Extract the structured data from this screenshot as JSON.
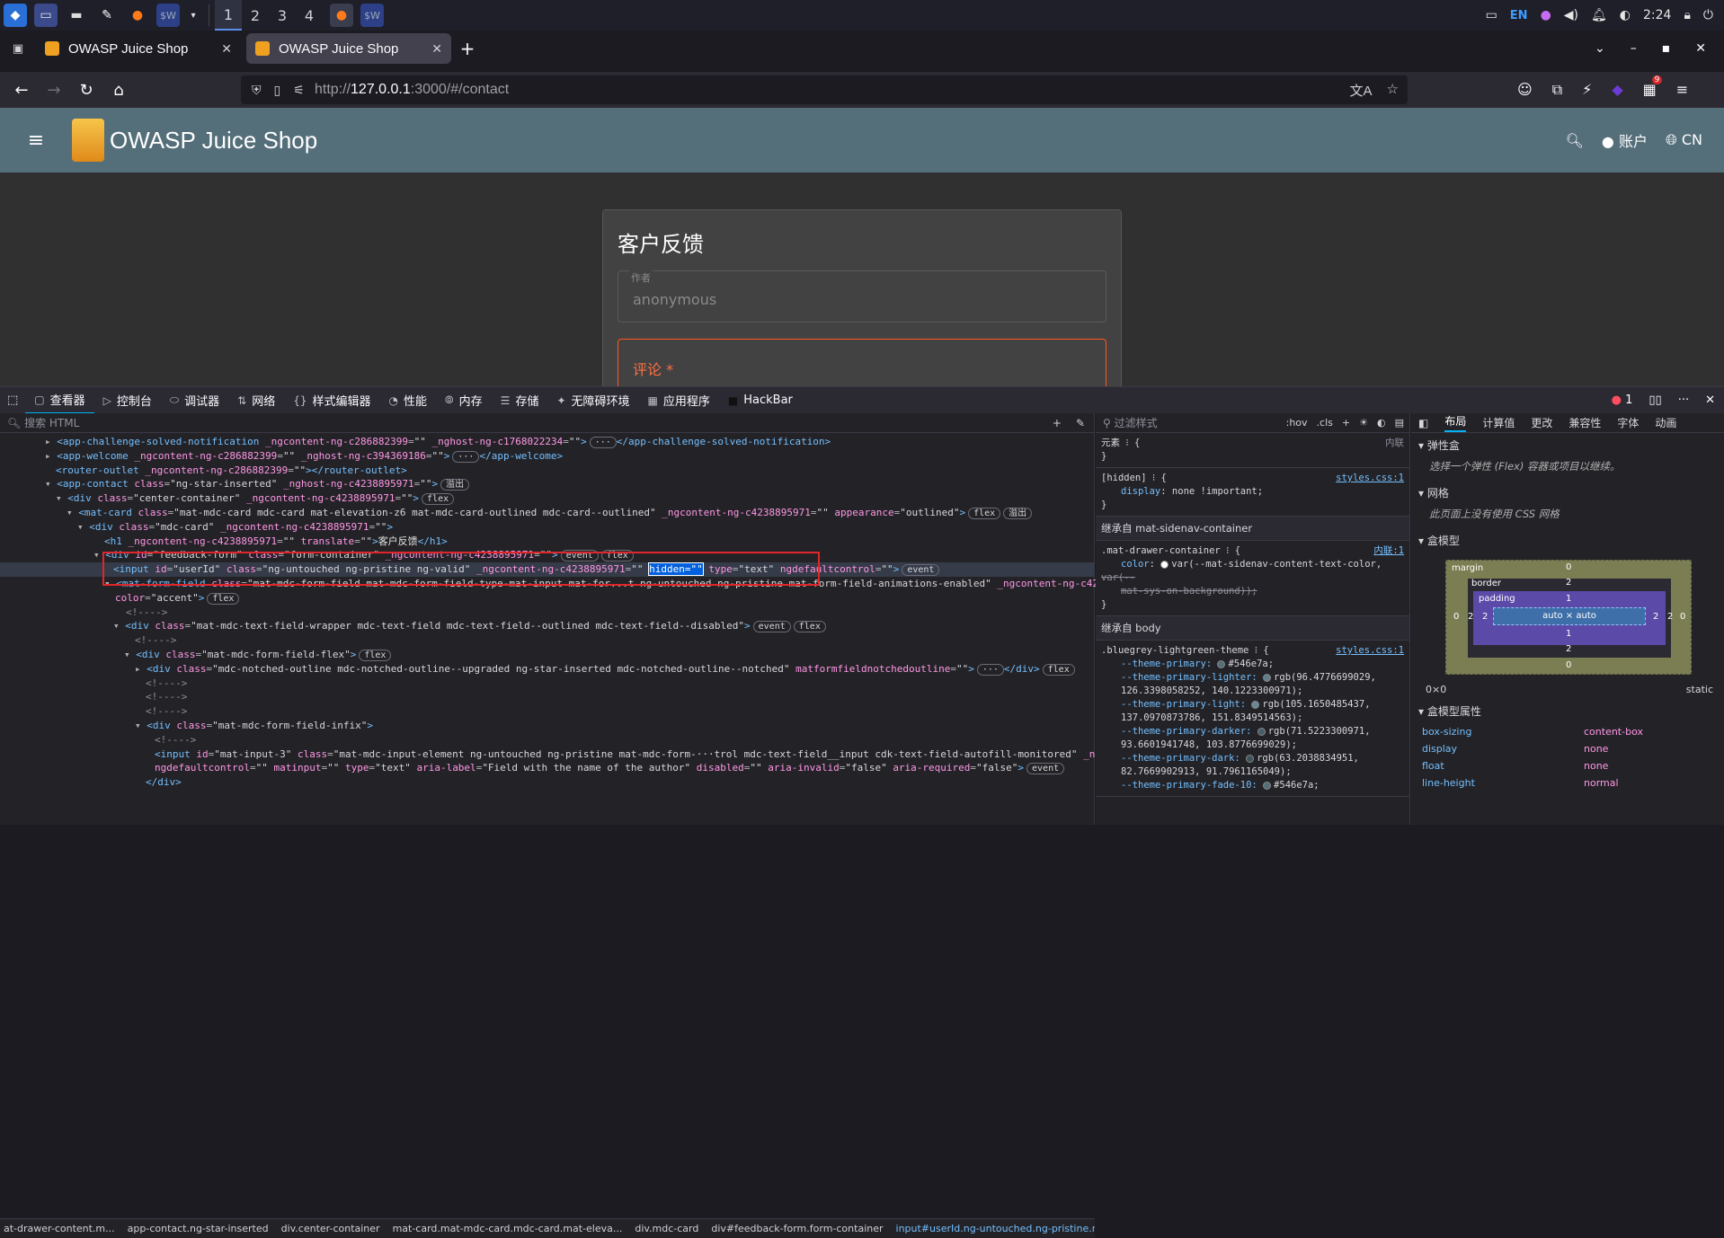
{
  "taskbar": {
    "workspaces": [
      "1",
      "2",
      "3",
      "4"
    ],
    "lang": "EN",
    "clock": "2:24",
    "icons": [
      "app-menu-icon",
      "terminal-icon",
      "files-icon",
      "editor-icon",
      "firefox-icon",
      "terminal-w-icon"
    ]
  },
  "browser": {
    "tabs": [
      {
        "title": "OWASP Juice Shop"
      },
      {
        "title": "OWASP Juice Shop"
      }
    ],
    "url_dim": "http://",
    "url_host": "127.0.0.1",
    "url_rest": ":3000/#/contact",
    "badge_count": "9"
  },
  "app": {
    "title": "OWASP Juice Shop",
    "account": "账户",
    "language": "CN"
  },
  "form": {
    "heading": "客户反馈",
    "author_label": "作者",
    "author_value": "anonymous",
    "comment_label": "评论 *"
  },
  "devtools": {
    "tabs": [
      {
        "label": "查看器",
        "active": true
      },
      {
        "label": "控制台"
      },
      {
        "label": "调试器"
      },
      {
        "label": "网络"
      },
      {
        "label": "样式编辑器"
      },
      {
        "label": "性能"
      },
      {
        "label": "内存"
      },
      {
        "label": "存储"
      },
      {
        "label": "无障碍环境"
      },
      {
        "label": "应用程序"
      },
      {
        "label": "HackBar"
      }
    ],
    "error_count": "1",
    "search_placeholder": "搜索 HTML",
    "filter_placeholder": "过滤样式",
    "hov": ":hov",
    "cls": ".cls",
    "right_tabs": [
      "布局",
      "计算值",
      "更改",
      "兼容性",
      "字体",
      "动画"
    ],
    "breadcrumbs": [
      "at-drawer-content.m...",
      "app-contact.ng-star-inserted",
      "div.center-container",
      "mat-card.mat-mdc-card.mdc-card.mat-eleva...",
      "div.mdc-card",
      "div#feedback-form.form-container",
      "input#userId.ng-untouched.ng-pristine.ng..."
    ],
    "rules": {
      "element_label": "元素",
      "inline": "内联",
      "hidden_sel": "[hidden]",
      "hidden_prop": "display",
      "hidden_val": "none !important;",
      "styles_src": "styles.css:1",
      "inherit1": "继承自 mat-sidenav-container",
      "drawer_sel": ".mat-drawer-container",
      "inline1": "内联:1",
      "color_prop": "color",
      "color_val": "var(--mat-sidenav-content-text-color,",
      "color_val2": "var(--",
      "color_val3": "mat-sys-on-background));",
      "inherit2": "继承自 body",
      "theme_sel": ".bluegrey-lightgreen-theme",
      "theme_props": [
        {
          "k": "--theme-primary:",
          "v": "#546e7a;",
          "c": "#546e7a"
        },
        {
          "k": "--theme-primary-lighter:",
          "v": "rgb(96.4776699029,",
          "v2": "126.3398058252, 140.1223300971);",
          "c": "#607e8c"
        },
        {
          "k": "--theme-primary-light:",
          "v": "rgb(105.1650485437,",
          "v2": "137.0970873786, 151.8349514563);",
          "c": "#698997"
        },
        {
          "k": "--theme-primary-darker:",
          "v": "rgb(71.5223300971,",
          "v2": "93.6601941748, 103.8776699029);",
          "c": "#475d67"
        },
        {
          "k": "--theme-primary-dark:",
          "v": "rgb(63.2038834951,",
          "v2": "82.7669902913, 91.7961165049);",
          "c": "#3f525b"
        },
        {
          "k": "--theme-primary-fade-10:",
          "v": "#546e7a;",
          "c": "#546e7a"
        }
      ]
    },
    "layout": {
      "flexbox": "弹性盒",
      "flex_desc": "选择一个弹性 (Flex) 容器或项目以继续。",
      "grid": "网格",
      "grid_desc": "此页面上没有使用 CSS 网格",
      "boxmodel": "盒模型",
      "bm_margin": "margin",
      "bm_border": "border",
      "bm_padding": "padding",
      "bm_content": "auto × auto",
      "bm_nums": {
        "m": "0",
        "b": "2",
        "p": "1"
      },
      "size": "0×0",
      "position": "static",
      "props_title": "盒模型属性",
      "props": [
        {
          "k": "box-sizing",
          "v": "content-box"
        },
        {
          "k": "display",
          "v": "none"
        },
        {
          "k": "float",
          "v": "none"
        },
        {
          "k": "line-height",
          "v": "normal"
        }
      ]
    }
  }
}
